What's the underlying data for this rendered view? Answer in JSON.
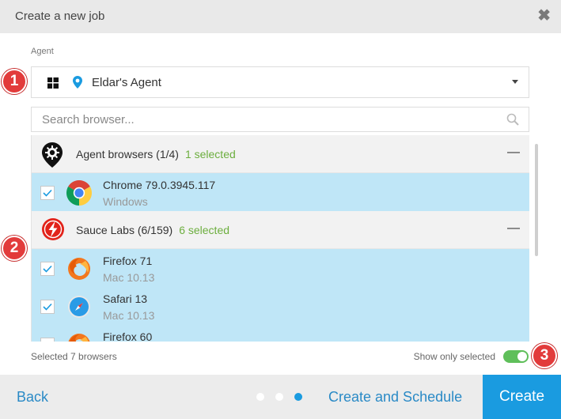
{
  "dialog": {
    "title": "Create a new job",
    "close_glyph": "✖"
  },
  "agent": {
    "label": "Agent",
    "name": "Eldar's Agent",
    "os_icon": "windows-icon",
    "location_icon": "map-pin-icon"
  },
  "search": {
    "placeholder": "Search browser...",
    "value": ""
  },
  "groups": [
    {
      "name": "Agent browsers (1/4)",
      "selected": "1 selected",
      "collapse": "—",
      "icon": "agent-pin-icon",
      "items": [
        {
          "name": "Chrome 79.0.3945.117",
          "os": "Windows",
          "checked": true,
          "icon": "chrome-icon"
        }
      ]
    },
    {
      "name": "Sauce Labs (6/159)",
      "selected": "6 selected",
      "collapse": "—",
      "icon": "sauce-labs-icon",
      "items": [
        {
          "name": "Firefox 71",
          "os": "Mac 10.13",
          "checked": true,
          "icon": "firefox-icon"
        },
        {
          "name": "Safari 13",
          "os": "Mac 10.13",
          "checked": true,
          "icon": "safari-icon"
        },
        {
          "name": "Firefox 60",
          "os": "",
          "checked": true,
          "icon": "firefox-icon"
        }
      ]
    }
  ],
  "footer": {
    "count": "Selected 7 browsers",
    "show_only_selected": "Show only selected",
    "toggle_on": true
  },
  "actions": {
    "back": "Back",
    "create_and_schedule": "Create and Schedule",
    "create": "Create",
    "step_current": 3,
    "step_total": 3
  },
  "badges": [
    "1",
    "2",
    "3"
  ],
  "colors": {
    "accent": "#1a9be0",
    "selected_row": "#bfe6f7",
    "selected_count": "#6cae3e",
    "badge": "#e23b3b",
    "toggle": "#5fbf5a"
  }
}
